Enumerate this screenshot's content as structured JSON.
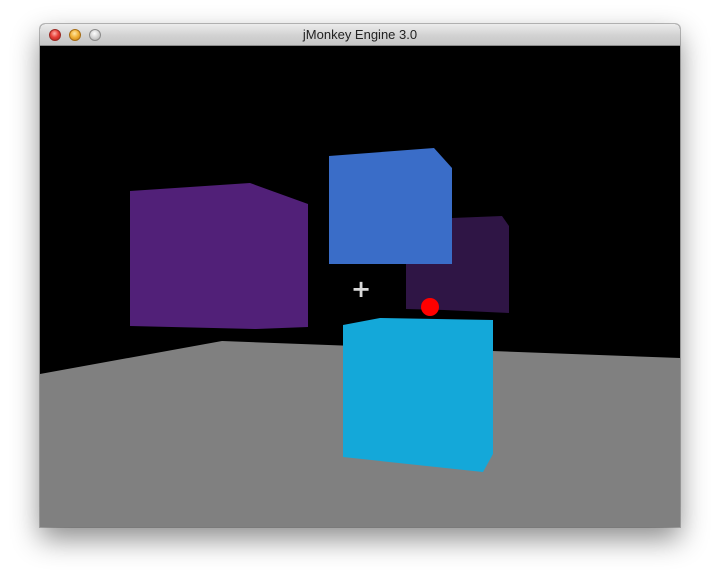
{
  "window": {
    "title": "jMonkey Engine 3.0",
    "controls": [
      "close",
      "minimize",
      "zoom"
    ]
  },
  "scene": {
    "background_color": "#000000",
    "floor_color": "#808080",
    "crosshair_symbol": "+",
    "crosshair_color": "#d9d9d9",
    "target_marker_color": "#ff0000",
    "cubes": [
      {
        "name": "purple",
        "color": "#512078"
      },
      {
        "name": "blue",
        "color": "#3a6dc8"
      },
      {
        "name": "dark-purple",
        "color": "#2f1545"
      },
      {
        "name": "cyan",
        "color": "#14a8d9"
      }
    ]
  }
}
